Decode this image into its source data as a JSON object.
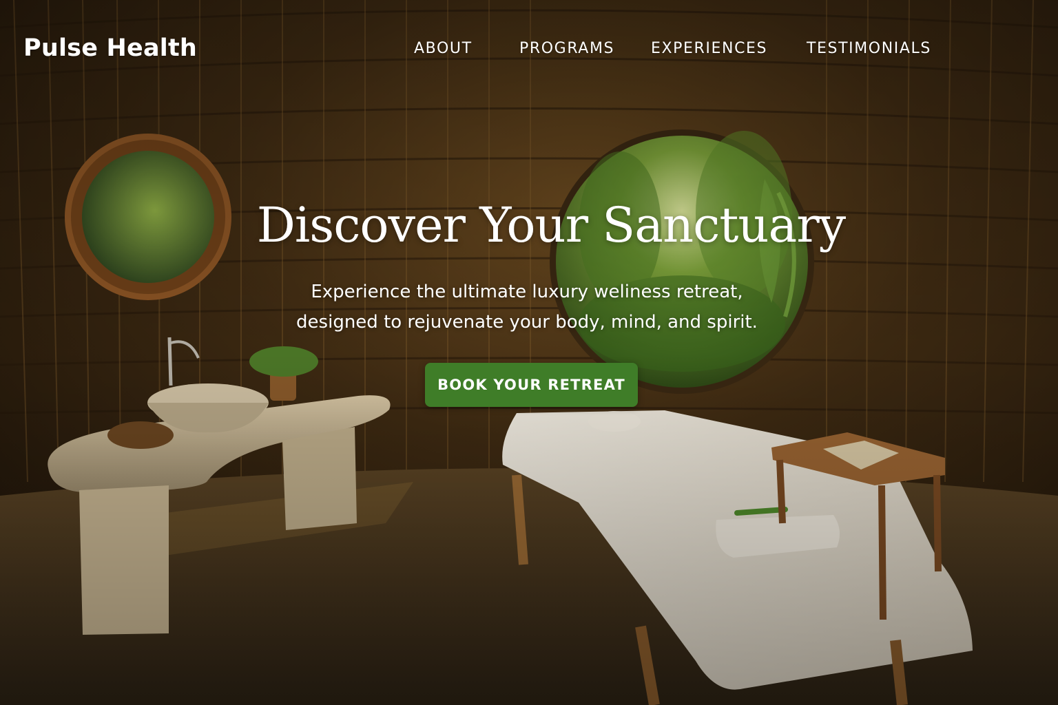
{
  "brand": {
    "name": "Pulse Health"
  },
  "nav": {
    "items": [
      {
        "label": "ABOUT"
      },
      {
        "label": "PROGRAMS"
      },
      {
        "label": "EXPERIENCES"
      },
      {
        "label": "TESTIMONIALS"
      }
    ]
  },
  "hero": {
    "title": "Discover Your Sanctuary",
    "subtitle_line1": "Experience the ultimate luxury weliness retreat,",
    "subtitle_line2": "designed to rejuvenate your body, mind, and spirit.",
    "cta_label": "BOOK YOUR RETREAT"
  },
  "colors": {
    "cta_background": "#3f7d28",
    "text": "#ffffff"
  }
}
